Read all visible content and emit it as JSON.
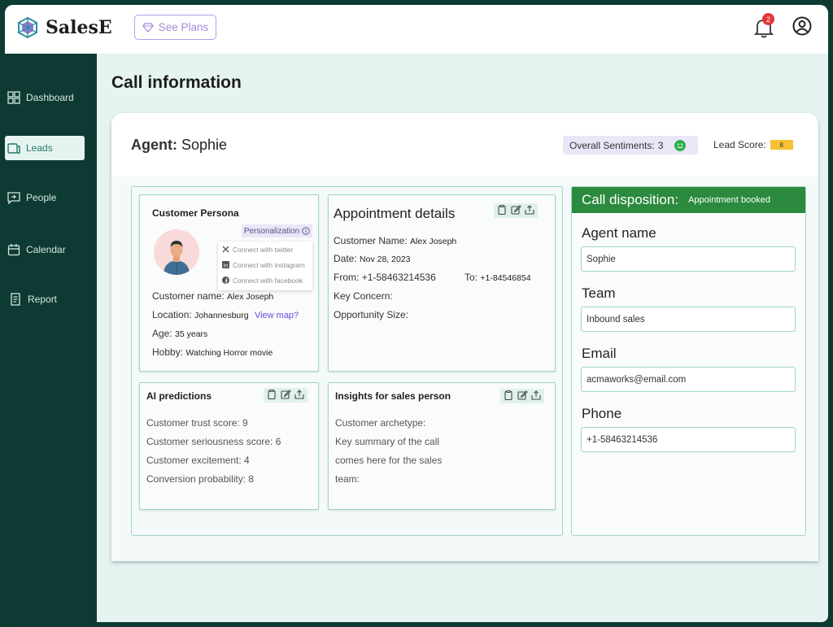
{
  "app": {
    "name": "SalesE",
    "plans_label": "See Plans",
    "notifications_count": "2"
  },
  "sidebar": {
    "items": [
      {
        "label": "Dashboard",
        "icon": "grid-icon"
      },
      {
        "label": "Leads",
        "icon": "leads-icon",
        "active": true
      },
      {
        "label": "People",
        "icon": "chat-icon"
      },
      {
        "label": "Calendar",
        "icon": "calendar-icon"
      },
      {
        "label": "Report",
        "icon": "report-icon"
      }
    ]
  },
  "page": {
    "title": "Call information"
  },
  "header": {
    "agent_label": "Agent:",
    "agent_name": "Sophie",
    "sentiment_label": "Overall Sentiments:",
    "sentiment_value": "3",
    "lead_score_label": "Lead Score:",
    "lead_score_value": "8"
  },
  "persona": {
    "title": "Customer Persona",
    "personalization_label": "Personalization",
    "connect": [
      "Connect with twitter",
      "Connect with instagram",
      "Connect with facebook"
    ],
    "name_label": "Customer name:",
    "name_value": "Alex Joseph",
    "location_label": "Location:",
    "location_value": "Johannesburg",
    "map_link": "View map?",
    "age_label": "Age:",
    "age_value": "35 years",
    "hobby_label": "Hobby:",
    "hobby_value": "Watching Horror movie"
  },
  "appointment": {
    "title": "Appointment details",
    "name_label": "Customer Name:",
    "name_value": "Alex Joseph",
    "date_label": "Date:",
    "date_value": "Nov 28, 2023",
    "from_label": "From:",
    "from_value": "+1-58463214536",
    "to_label": "To:",
    "to_value": "+1-84546854",
    "concern_label": "Key Concern:",
    "opportunity_label": "Opportunity Size:"
  },
  "predictions": {
    "title": "AI predictions",
    "lines": [
      "Customer trust score: 9",
      "Customer seriousness score: 6",
      "Customer excitement: 4",
      "Conversion probability: 8"
    ]
  },
  "insights": {
    "title": "Insights for sales person",
    "lines": [
      "Customer archetype:",
      "Key summary of the call",
      "comes here for the sales",
      "team:"
    ]
  },
  "disposition": {
    "title": "Call disposition:",
    "status": "Appointment booked",
    "fields": [
      {
        "label": "Agent name",
        "value": "Sophie"
      },
      {
        "label": "Team",
        "value": "Inbound sales"
      },
      {
        "label": "Email",
        "value": "acmaworks@email.com"
      },
      {
        "label": "Phone",
        "value": "+1-58463214536"
      }
    ]
  },
  "colors": {
    "sidebar_bg": "#0d3b33",
    "accent_green": "#2b8a3e",
    "main_bg": "#e5f3f1",
    "purple": "#a58ad8"
  }
}
